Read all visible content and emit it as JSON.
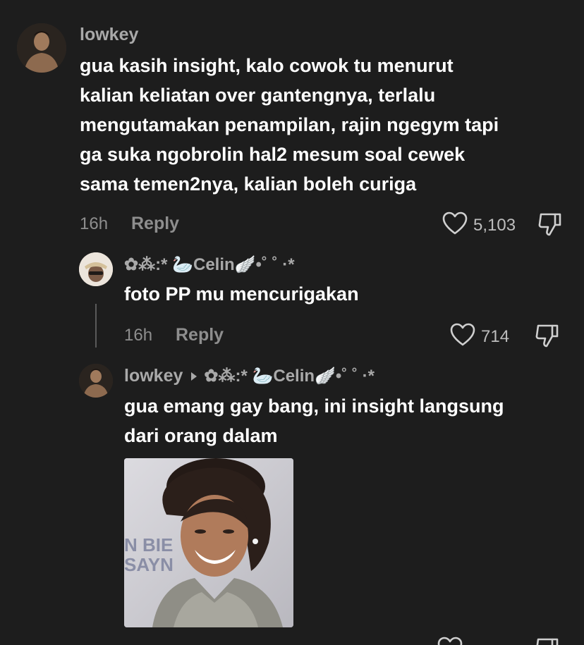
{
  "comments": [
    {
      "username": "lowkey",
      "text_lines": [
        "gua kasih insight, kalo cowok tu menurut",
        "kalian keliatan over gantengnya, terlalu",
        "mengutamakan penampilan, rajin ngegym tapi",
        "ga suka ngobrolin hal2 mesum soal cewek",
        "sama temen2nya, kalian boleh curiga"
      ],
      "time": "16h",
      "reply_label": "Reply",
      "likes": "5,103"
    },
    {
      "username": "✿⁂:* 🦢Celin🪽•˚ ˚ ·*",
      "text_lines": [
        "foto PP mu mencurigakan"
      ],
      "time": "16h",
      "reply_label": "Reply",
      "likes": "714"
    },
    {
      "username": "lowkey",
      "reply_to": "✿⁂:* 🦢Celin🪽•˚ ˚ ·*",
      "text_lines": [
        "gua emang gay bang, ini insight langsung",
        "dari orang dalam"
      ]
    }
  ],
  "icons": {
    "like": "heart-outline-icon",
    "dislike": "thumbs-down-icon"
  },
  "colors": {
    "background": "#1d1d1d",
    "username": "#a9a9a9",
    "text": "#ffffff",
    "meta": "#8e8e8e"
  }
}
